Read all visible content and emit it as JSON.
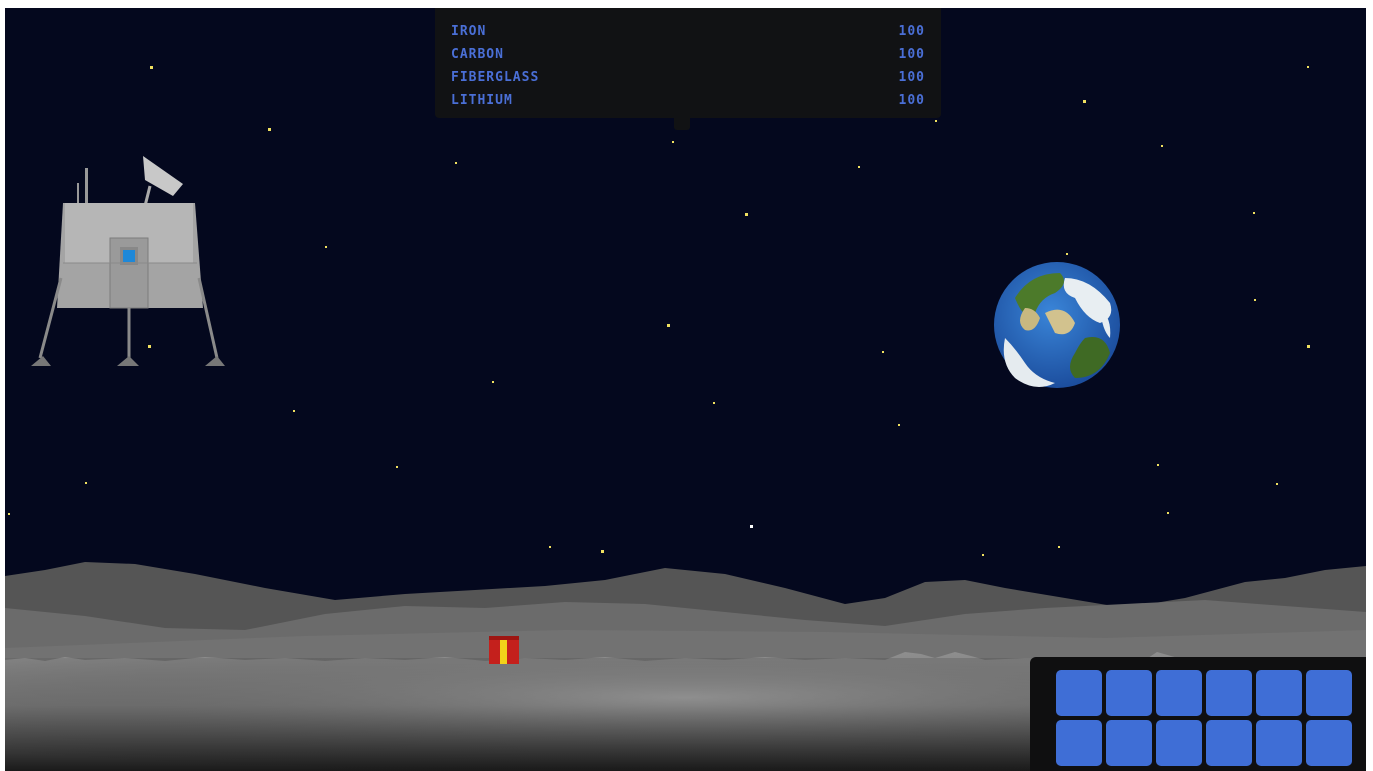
{
  "resources": [
    {
      "name": "IRON",
      "amount": "100"
    },
    {
      "name": "CARBON",
      "amount": "100"
    },
    {
      "name": "FIBERGLASS",
      "amount": "100"
    },
    {
      "name": "LITHIUM",
      "amount": "100"
    }
  ],
  "inventory": {
    "slot_count": 12,
    "columns": 6
  },
  "colors": {
    "hud_text": "#4a6fd6",
    "slot": "#3f6ed6",
    "sky": "#04081e",
    "gift_box": "#c4201c",
    "gift_ribbon": "#f2d21a"
  },
  "icons": {
    "lander": "lunar-lander-icon",
    "planet": "earth-icon",
    "item": "gift-box-icon"
  }
}
